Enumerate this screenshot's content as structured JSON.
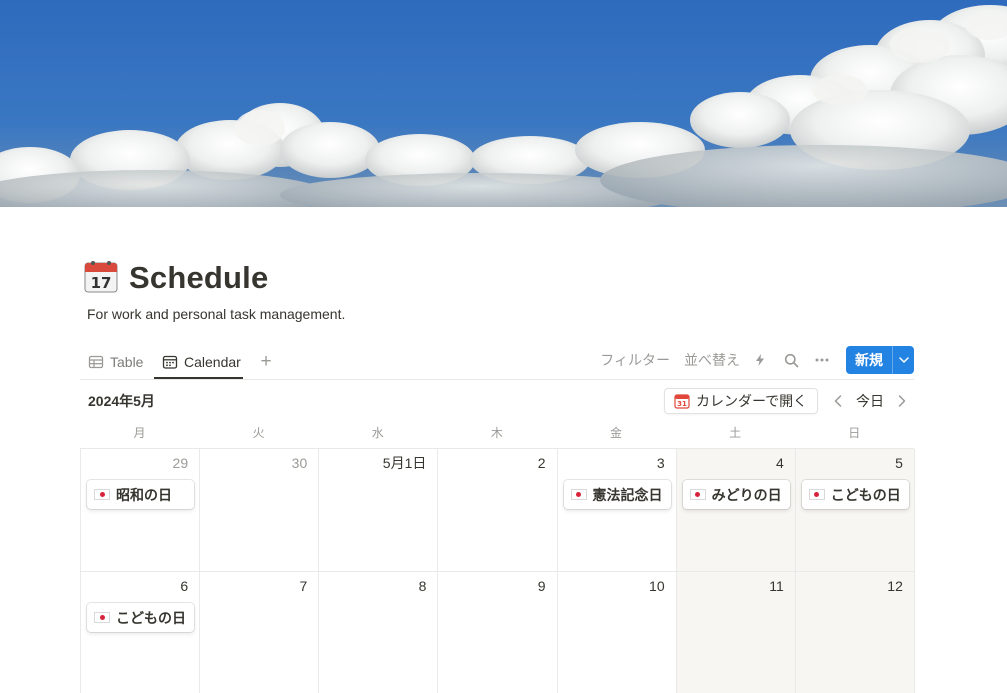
{
  "page": {
    "title": "Schedule",
    "description": "For work and personal task management.",
    "icon": "calendar-17-icon"
  },
  "views": {
    "tabs": [
      {
        "label": "Table",
        "icon": "table-icon",
        "active": false
      },
      {
        "label": "Calendar",
        "icon": "calendar-icon",
        "active": true
      }
    ],
    "add_icon": "plus-icon"
  },
  "toolbar": {
    "filter_label": "フィルター",
    "sort_label": "並べ替え",
    "automation_icon": "lightning-icon",
    "search_icon": "search-icon",
    "more_icon": "more-icon",
    "new_label": "新規",
    "new_dropdown_icon": "chevron-down-icon",
    "accent_color": "#2383e2"
  },
  "calendar": {
    "month_label": "2024年5月",
    "open_in_calendar_label": "カレンダーで開く",
    "today_label": "今日",
    "weekdays": [
      "月",
      "火",
      "水",
      "木",
      "金",
      "土",
      "日"
    ],
    "weeks": [
      {
        "days": [
          {
            "label": "29",
            "muted": true,
            "event": "昭和の日"
          },
          {
            "label": "30",
            "muted": true,
            "event": ""
          },
          {
            "label": "5月1日",
            "muted": false,
            "event": ""
          },
          {
            "label": "2",
            "muted": false,
            "event": ""
          },
          {
            "label": "3",
            "muted": false,
            "event": "憲法記念日"
          },
          {
            "label": "4",
            "muted": false,
            "event": "みどりの日"
          },
          {
            "label": "5",
            "muted": false,
            "event": "こどもの日"
          }
        ]
      },
      {
        "days": [
          {
            "label": "6",
            "muted": false,
            "event": "こどもの日"
          },
          {
            "label": "7",
            "muted": false,
            "event": ""
          },
          {
            "label": "8",
            "muted": false,
            "event": ""
          },
          {
            "label": "9",
            "muted": false,
            "event": ""
          },
          {
            "label": "10",
            "muted": false,
            "event": ""
          },
          {
            "label": "11",
            "muted": false,
            "event": ""
          },
          {
            "label": "12",
            "muted": false,
            "event": ""
          }
        ]
      }
    ],
    "event_icon": "japan-flag-icon"
  }
}
